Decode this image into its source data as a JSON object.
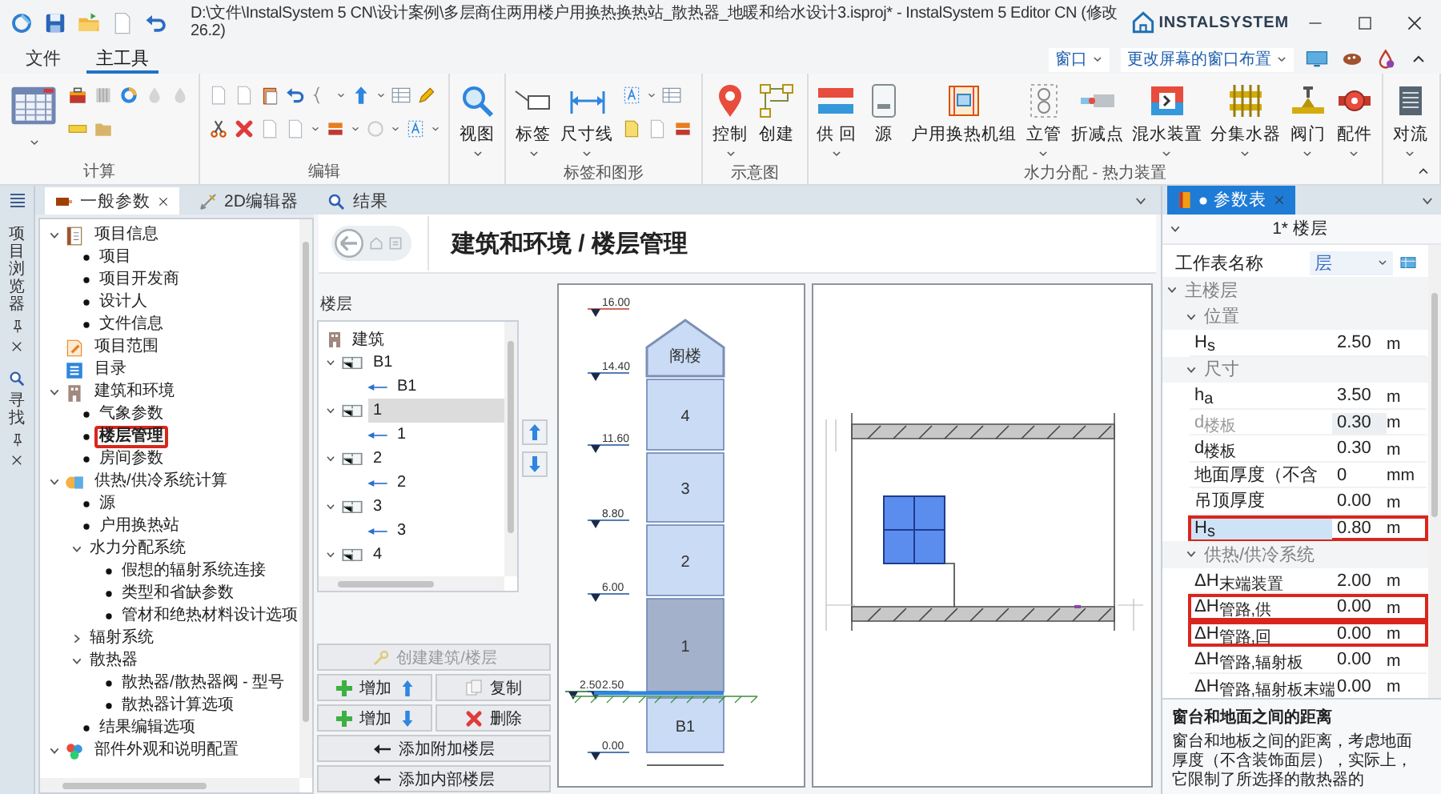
{
  "window": {
    "title": "D:\\文件\\InstalSystem 5 CN\\设计案例\\多层商住两用楼户用换热换热站_散热器_地暖和给水设计3.isproj* - InstalSystem 5 Editor CN (修改 26.2)",
    "brand": "INSTALSYSTEM"
  },
  "menu": {
    "tabs": [
      {
        "label": "文件",
        "selected": false
      },
      {
        "label": "主工具",
        "selected": true
      }
    ],
    "window_button": "窗口",
    "layout_button": "更改屏幕的窗口布置"
  },
  "ribbon": {
    "groups": [
      {
        "kind": "calc",
        "label": "计算"
      },
      {
        "kind": "edit",
        "label": "编辑"
      },
      {
        "kind": "view",
        "buttons": [
          {
            "label": "视图",
            "dropdown": true
          }
        ]
      },
      {
        "kind": "labels",
        "label": "标签和图形",
        "buttons": [
          {
            "label": "标签",
            "dropdown": true
          },
          {
            "label": "尺寸线",
            "dropdown": true
          }
        ]
      },
      {
        "kind": "schema",
        "label": "示意图",
        "buttons": [
          {
            "label": "控制",
            "dropdown": true
          },
          {
            "label": "创建",
            "dropdown": false
          }
        ]
      },
      {
        "kind": "hydraulic",
        "label": "水力分配 - 热力装置",
        "buttons": [
          {
            "label": "供 回",
            "dropdown": true
          },
          {
            "label": "源",
            "dropdown": false
          },
          {
            "label": "户用换热机组",
            "dropdown": false
          },
          {
            "label": "立管",
            "dropdown": true
          },
          {
            "label": "折减点",
            "dropdown": false
          },
          {
            "label": "混水装置",
            "dropdown": true
          },
          {
            "label": "分集水器",
            "dropdown": true
          },
          {
            "label": "阀门",
            "dropdown": true
          },
          {
            "label": "配件",
            "dropdown": true
          }
        ]
      },
      {
        "kind": "convection",
        "buttons": [
          {
            "label": "对流",
            "dropdown": true
          }
        ]
      }
    ]
  },
  "side_panels": [
    {
      "label": "项目浏览器"
    },
    {
      "label": "寻找"
    }
  ],
  "doc_tabs": [
    {
      "label": "一般参数",
      "selected": true,
      "closable": true
    },
    {
      "label": "2D编辑器",
      "selected": false,
      "closable": false
    },
    {
      "label": "结果",
      "selected": false,
      "closable": false
    }
  ],
  "project_tree": {
    "items": [
      {
        "label": "项目信息",
        "kind": "folder",
        "expanded": true,
        "selected": false,
        "children": [
          {
            "label": "项目",
            "kind": "leaf",
            "selected": false
          },
          {
            "label": "项目开发商",
            "kind": "leaf",
            "selected": false
          },
          {
            "label": "设计人",
            "kind": "leaf",
            "selected": false
          },
          {
            "label": "文件信息",
            "kind": "leaf",
            "selected": false
          }
        ]
      },
      {
        "label": "项目范围",
        "kind": "folder",
        "selected": false
      },
      {
        "label": "目录",
        "kind": "folder",
        "selected": false
      },
      {
        "label": "建筑和环境",
        "kind": "folder",
        "expanded": true,
        "selected": false,
        "children": [
          {
            "label": "气象参数",
            "kind": "leaf",
            "selected": false
          },
          {
            "label": "楼层管理",
            "kind": "leaf",
            "selected": true
          },
          {
            "label": "房间参数",
            "kind": "leaf",
            "selected": false
          }
        ]
      },
      {
        "label": "供热/供冷系统计算",
        "kind": "folder",
        "expanded": true,
        "selected": false,
        "children": [
          {
            "label": "源",
            "kind": "leaf",
            "selected": false
          },
          {
            "label": "户用换热站",
            "kind": "leaf",
            "selected": false
          },
          {
            "label": "水力分配系统",
            "kind": "group",
            "expanded": true,
            "selected": false,
            "children": [
              {
                "label": "假想的辐射系统连接",
                "kind": "leaf",
                "selected": false
              },
              {
                "label": "类型和省缺参数",
                "kind": "leaf",
                "selected": false
              },
              {
                "label": "管材和绝热材料设计选项",
                "kind": "leaf",
                "selected": false
              }
            ]
          },
          {
            "label": "辐射系统",
            "kind": "group",
            "expanded": false,
            "selected": false
          },
          {
            "label": "散热器",
            "kind": "group",
            "expanded": true,
            "selected": false,
            "children": [
              {
                "label": "散热器/散热器阀 - 型号",
                "kind": "leaf",
                "selected": false
              },
              {
                "label": "散热器计算选项",
                "kind": "leaf",
                "selected": false
              }
            ]
          },
          {
            "label": "结果编辑选项",
            "kind": "leaf",
            "selected": false
          }
        ]
      },
      {
        "label": "部件外观和说明配置",
        "kind": "folder",
        "expanded": true,
        "selected": false
      }
    ]
  },
  "floor_page": {
    "title": "建筑和环境 / 楼层管理",
    "floors_label": "楼层",
    "building": "建筑",
    "floors": [
      {
        "label": "B1",
        "expanded": true,
        "selected": false,
        "children": [
          {
            "label": "B1"
          }
        ]
      },
      {
        "label": "1",
        "expanded": true,
        "selected": true,
        "children": [
          {
            "label": "1"
          }
        ]
      },
      {
        "label": "2",
        "expanded": true,
        "selected": false,
        "children": [
          {
            "label": "2"
          }
        ]
      },
      {
        "label": "3",
        "expanded": true,
        "selected": false,
        "children": [
          {
            "label": "3"
          }
        ]
      },
      {
        "label": "4",
        "expanded": true,
        "selected": false
      }
    ],
    "buttons": [
      {
        "label": "创建建筑/楼层",
        "kind": "create",
        "disabled": true
      },
      {
        "label": "增加",
        "kind": "add-up",
        "disabled": false
      },
      {
        "label": "复制",
        "kind": "copy",
        "disabled": false
      },
      {
        "label": "增加",
        "kind": "add-down",
        "disabled": false
      },
      {
        "label": "删除",
        "kind": "delete",
        "disabled": false
      },
      {
        "label": "添加附加楼层",
        "kind": "add-extra",
        "disabled": false
      },
      {
        "label": "添加内部楼层",
        "kind": "add-inner",
        "disabled": false
      }
    ],
    "section": {
      "levels": [
        {
          "label": "16.00",
          "kind": "top"
        },
        {
          "label": "14.40",
          "kind": "floor"
        },
        {
          "label": "11.60",
          "kind": "floor"
        },
        {
          "label": "8.80",
          "kind": "floor"
        },
        {
          "label": "6.00",
          "kind": "floor"
        },
        {
          "label": "2.50",
          "kind": "ground"
        },
        {
          "label": "2.50",
          "kind": "floor"
        },
        {
          "label": "0.00",
          "kind": "floor"
        }
      ],
      "floors": [
        {
          "label": "阁楼",
          "kind": "roof",
          "selected": false
        },
        {
          "label": "4",
          "kind": "storey",
          "selected": false
        },
        {
          "label": "3",
          "kind": "storey",
          "selected": false
        },
        {
          "label": "2",
          "kind": "storey",
          "selected": false
        },
        {
          "label": "1",
          "kind": "storey",
          "selected": true
        },
        {
          "label": "B1",
          "kind": "storey",
          "selected": false
        }
      ]
    }
  },
  "parameters": {
    "tab": {
      "label": "参数表",
      "selected": true
    },
    "title": "1* 楼层",
    "sheet": {
      "label": "工作表名称",
      "value": "层"
    },
    "groups": [
      {
        "label": "主楼层",
        "expanded": true,
        "children": [
          {
            "label": "位置",
            "expanded": true,
            "rows": [
              {
                "name": "H$_{s}$",
                "value": "2.50",
                "unit": "m",
                "selected": false,
                "disabled": false,
                "highlighted": false
              }
            ]
          },
          {
            "label": "尺寸",
            "expanded": true,
            "rows": [
              {
                "name": "h$_{a}$",
                "value": "3.50",
                "unit": "m",
                "selected": false,
                "disabled": false,
                "highlighted": false
              },
              {
                "name": "d$_{楼板}$",
                "value": "0.30",
                "unit": "m",
                "selected": false,
                "disabled": true,
                "highlighted": false
              },
              {
                "name": "d$_{楼板}$",
                "value": "0.30",
                "unit": "m",
                "selected": false,
                "disabled": false,
                "highlighted": false
              },
              {
                "name": "地面厚度（不含",
                "value": "0",
                "unit": "mm",
                "selected": false,
                "disabled": false,
                "highlighted": false
              },
              {
                "name": "吊顶厚度",
                "value": "0.00",
                "unit": "m",
                "selected": false,
                "disabled": false,
                "highlighted": false
              },
              {
                "name": "H$_{s}$",
                "value": "0.80",
                "unit": "m",
                "selected": true,
                "disabled": false,
                "highlighted": true
              }
            ]
          },
          {
            "label": "供热/供冷系统",
            "expanded": true,
            "rows": [
              {
                "name": "ΔH$_{末端装置}$",
                "value": "2.00",
                "unit": "m",
                "selected": false,
                "disabled": false,
                "highlighted": false
              },
              {
                "name": "ΔH$_{管路,供}$",
                "value": "0.00",
                "unit": "m",
                "selected": false,
                "disabled": false,
                "highlighted": true
              },
              {
                "name": "ΔH$_{管路,回}$",
                "value": "0.00",
                "unit": "m",
                "selected": false,
                "disabled": false,
                "highlighted": true
              },
              {
                "name": "ΔH$_{管路,辐射板}$",
                "value": "0.00",
                "unit": "m",
                "selected": false,
                "disabled": false,
                "highlighted": false
              },
              {
                "name": "ΔH$_{管路,辐射板末端}$",
                "value": "0.00",
                "unit": "m",
                "selected": false,
                "disabled": false,
                "highlighted": false
              }
            ]
          }
        ]
      }
    ],
    "description": {
      "title": "窗台和地面之间的距离",
      "text": "窗台和地板之间的距离，考虑地面厚度（不含装饰面层），实际上，它限制了所选择的散热器的"
    }
  }
}
